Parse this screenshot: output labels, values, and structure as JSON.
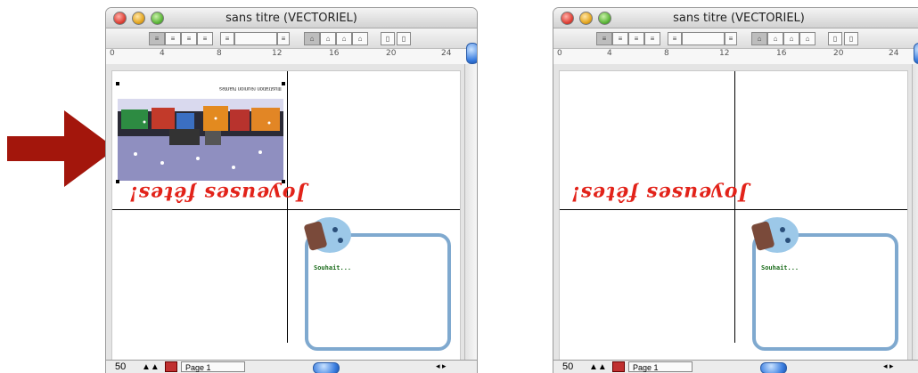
{
  "windows": [
    {
      "title": "sans titre (VECTORIEL)",
      "zoom": "50",
      "page_label": "Page 1",
      "ruler_labels": [
        "0",
        "4",
        "8",
        "12",
        "16",
        "20",
        "24"
      ],
      "greeting": "Joyeuses fêtes!",
      "wish": "Souhait...",
      "image_caption": "Illustration réunion Nantes",
      "selected_image": true
    },
    {
      "title": "sans titre (VECTORIEL)",
      "zoom": "50",
      "page_label": "Page 1",
      "ruler_labels": [
        "0",
        "4",
        "8",
        "12",
        "16",
        "20",
        "24"
      ],
      "greeting": "Joyeuses fêtes!",
      "wish": "Souhait...",
      "selected_image": false
    }
  ],
  "arrow_color": "#a3160c",
  "accent_color": "#7fa9cf",
  "greeting_color": "#e2231a"
}
